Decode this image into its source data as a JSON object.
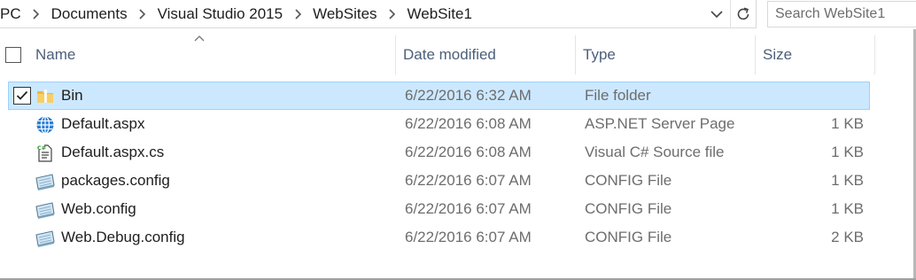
{
  "address": {
    "crumbs": [
      "PC",
      "Documents",
      "Visual Studio 2015",
      "WebSites",
      "WebSite1"
    ]
  },
  "search": {
    "placeholder": "Search WebSite1"
  },
  "columns": {
    "name": "Name",
    "date": "Date modified",
    "type": "Type",
    "size": "Size"
  },
  "files": [
    {
      "name": "Bin",
      "icon": "folder-icon",
      "date": "6/22/2016 6:32 AM",
      "type": "File folder",
      "size": "",
      "selected": true
    },
    {
      "name": "Default.aspx",
      "icon": "globe-icon",
      "date": "6/22/2016 6:08 AM",
      "type": "ASP.NET Server Page",
      "size": "1 KB",
      "selected": false
    },
    {
      "name": "Default.aspx.cs",
      "icon": "csharp-file-icon",
      "date": "6/22/2016 6:08 AM",
      "type": "Visual C# Source file",
      "size": "1 KB",
      "selected": false
    },
    {
      "name": "packages.config",
      "icon": "config-file-icon",
      "date": "6/22/2016 6:07 AM",
      "type": "CONFIG File",
      "size": "1 KB",
      "selected": false
    },
    {
      "name": "Web.config",
      "icon": "config-file-icon",
      "date": "6/22/2016 6:07 AM",
      "type": "CONFIG File",
      "size": "1 KB",
      "selected": false
    },
    {
      "name": "Web.Debug.config",
      "icon": "config-file-icon",
      "date": "6/22/2016 6:07 AM",
      "type": "CONFIG File",
      "size": "2 KB",
      "selected": false
    }
  ],
  "colors": {
    "selection": "#cce8ff",
    "selection_border": "#99d1ff",
    "header_text": "#4c607a"
  }
}
